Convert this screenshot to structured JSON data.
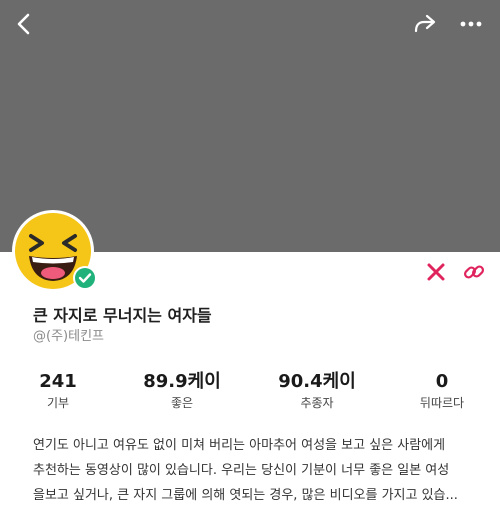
{
  "profile": {
    "name": "큰 자지로 무너지는 여자들",
    "handle": "@(주)테킨프"
  },
  "stats": [
    {
      "value": "241",
      "label": "기부"
    },
    {
      "value": "89.9케이",
      "label": "좋은"
    },
    {
      "value": "90.4케이",
      "label": "추종자"
    },
    {
      "value": "0",
      "label": "뒤따르다"
    }
  ],
  "description": {
    "line1": "연기도 아니고 여유도 없이 미쳐 버리는 아마추어 여성을 보고 싶은 사람에게",
    "line2": "추천하는 동영상이 많이 있습니다. 우리는 당신이 기분이 너무 좋은 일본 여성",
    "line3": "을보고 싶거나, 큰 자지 그룹에 의해 엿되는 경우, 많은 비디오를 가지고 있습..."
  },
  "icons": {
    "back": "chevron-left-icon",
    "share": "share-arrow-icon",
    "more": "more-dots-icon",
    "avatar": "grinning-squinting-emoji",
    "verified": "verified-check-icon",
    "social_x": "x-logo-icon",
    "social_link": "link-icon"
  },
  "colors": {
    "banner": "#6b6b6b",
    "accent": "#e0245e",
    "verified": "#20b27a",
    "emoji": "#f5c518"
  }
}
